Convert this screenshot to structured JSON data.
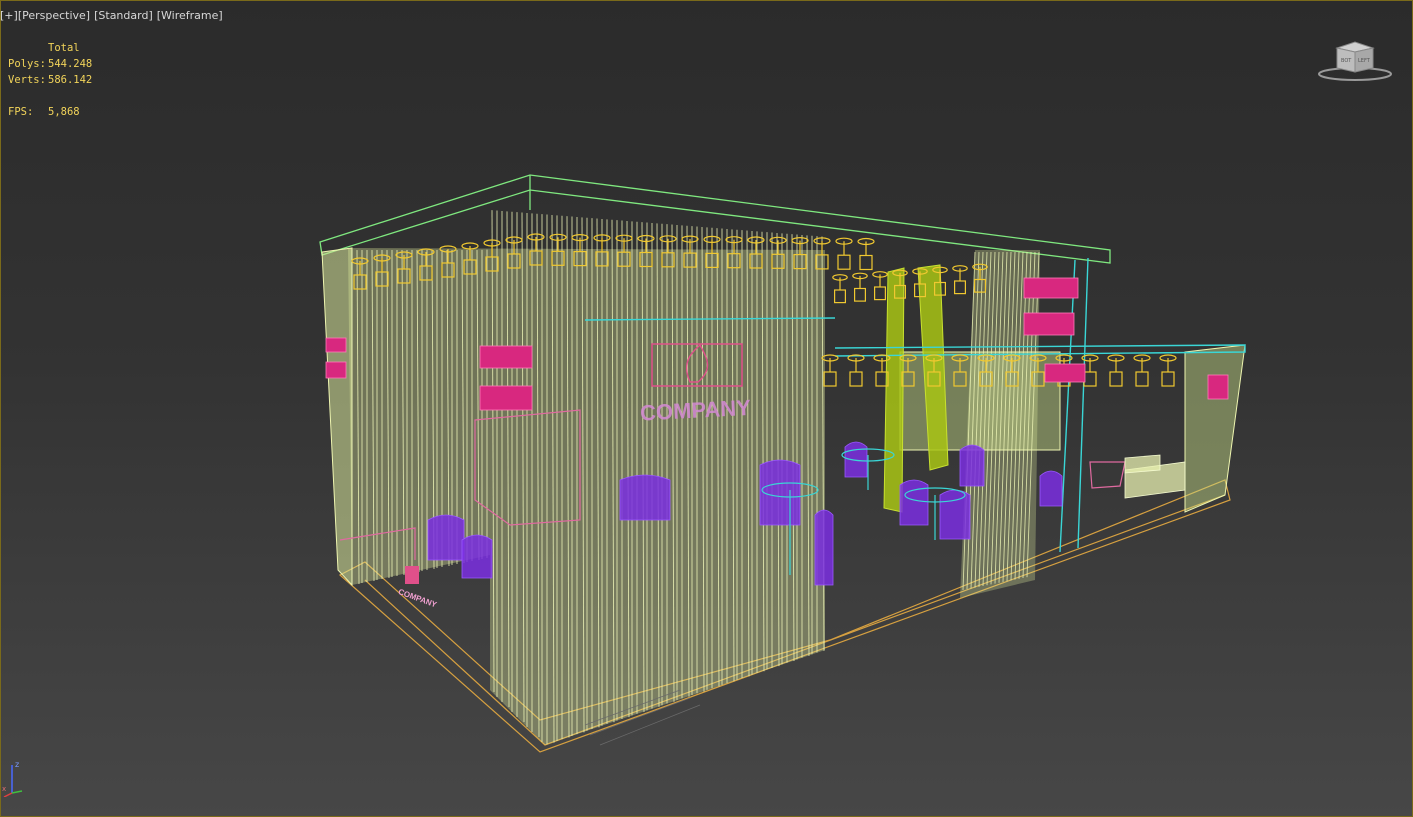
{
  "viewport": {
    "plus_label": "[+]",
    "view_label": "[Perspective]",
    "shading_label": "[Standard]",
    "style_label": "[Wireframe]"
  },
  "stats": {
    "total_label": "Total",
    "polys_label": "Polys:",
    "polys_value": "544.248",
    "verts_label": "Verts:",
    "verts_value": "586.142",
    "fps_label": "FPS:",
    "fps_value": "5,868"
  },
  "scene": {
    "logo_text": "COMPANY",
    "small_logo_text": "COMPANY"
  },
  "viewcube": {
    "face_left": "BOT",
    "face_right": "LEFT"
  },
  "gizmo": {
    "axis_z": "z",
    "axis_x": "x"
  },
  "colors": {
    "wire_yellow": "#e8ee9c",
    "wire_gold": "#f0c830",
    "wire_green": "#7fe87f",
    "wire_magenta": "#e0308a",
    "wire_purple": "#7a2ee0",
    "wire_cyan": "#3ad6d6",
    "wire_olive": "#a8c414",
    "wire_orange": "#d6a040",
    "stats_text": "#f2d45a"
  }
}
